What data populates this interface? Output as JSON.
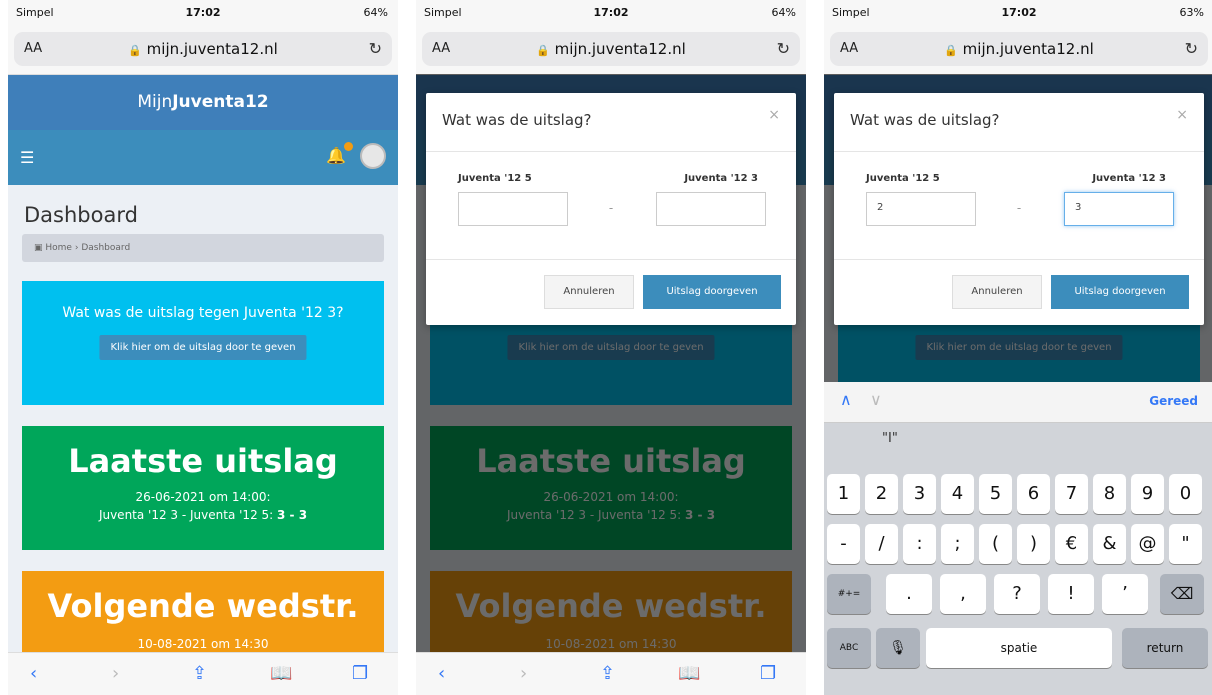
{
  "status": [
    {
      "carrier": "Simpel",
      "time": "17:02",
      "battery": "64%"
    },
    {
      "carrier": "Simpel",
      "time": "17:02",
      "battery": "64%"
    },
    {
      "carrier": "Simpel",
      "time": "17:02",
      "battery": "63%"
    }
  ],
  "browser": {
    "aa_label": "AA",
    "url": "mijn.juventa12.nl",
    "toolbar_icons": [
      "back-icon",
      "forward-icon",
      "share-icon",
      "bookmarks-icon",
      "tabs-icon"
    ]
  },
  "app": {
    "brand_light": "Mijn",
    "brand_bold": "Juventa12"
  },
  "dashboard": {
    "title": "Dashboard",
    "breadcrumb_home": "Home",
    "breadcrumb_current": "Dashboard",
    "question_text": "Wat was de uitslag tegen Juventa '12 3?",
    "question_button": "Klik hier om de uitslag door te geven",
    "last_result_heading": "Laatste uitslag",
    "last_result_date": "26-06-2021 om 14:00:",
    "last_result_teams": "Juventa '12 3 - Juventa '12 5: ",
    "last_result_score": "3 - 3",
    "next_match_heading": "Volgende wedstr.",
    "next_match_date": "10-08-2021 om 14:30"
  },
  "modal": {
    "title": "Wat was de uitslag?",
    "team_home": "Juventa '12 5",
    "team_away": "Juventa '12 3",
    "separator": "-",
    "cancel_label": "Annuleren",
    "submit_label": "Uitslag doorgeven",
    "filled_home": "2",
    "filled_away": "3"
  },
  "keyboard": {
    "done_label": "Gereed",
    "suggestion": "\"I\"",
    "row1": [
      "1",
      "2",
      "3",
      "4",
      "5",
      "6",
      "7",
      "8",
      "9",
      "0"
    ],
    "row2": [
      "-",
      "/",
      ":",
      ";",
      "(",
      ")",
      "€",
      "&",
      "@",
      "\""
    ],
    "row3_left": "#+=",
    "row3": [
      ".",
      ",",
      "?",
      "!",
      "’"
    ],
    "abc_label": "ABC",
    "space_label": "spatie",
    "return_label": "return"
  },
  "colors": {
    "primary": "#3c8dbc",
    "info": "#00c0ef",
    "success": "#00a65a",
    "warning": "#f39c12"
  }
}
